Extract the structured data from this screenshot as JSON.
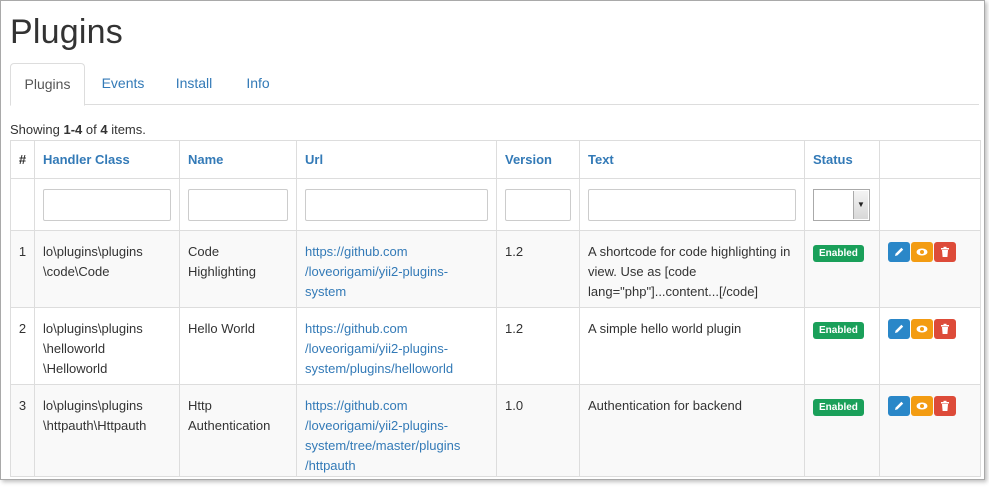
{
  "page": {
    "title": "Plugins"
  },
  "tabs": [
    {
      "label": "Plugins",
      "active": true
    },
    {
      "label": "Events"
    },
    {
      "label": "Install"
    },
    {
      "label": "Info"
    }
  ],
  "summary": {
    "prefix": "Showing ",
    "range": "1-4",
    "middle": " of ",
    "total": "4",
    "suffix": " items."
  },
  "table": {
    "headers": {
      "hash": "#",
      "handler": "Handler Class",
      "name": "Name",
      "url": "Url",
      "version": "Version",
      "text": "Text",
      "status": "Status"
    },
    "rows": [
      {
        "num": "1",
        "handler": [
          "lo\\plugins\\plugins",
          "\\code\\Code"
        ],
        "name": [
          "Code",
          "Highlighting"
        ],
        "url": [
          "https://github.com",
          "/loveorigami/yii2-plugins-",
          "system"
        ],
        "version": "1.2",
        "text": [
          "A shortcode for code highlighting in",
          "view. Use as [code",
          "lang=\"php\"]...content...[/code]"
        ],
        "status": "Enabled"
      },
      {
        "num": "2",
        "handler": [
          "lo\\plugins\\plugins",
          "\\helloworld",
          "\\Helloworld"
        ],
        "name": [
          "Hello World"
        ],
        "url": [
          "https://github.com",
          "/loveorigami/yii2-plugins-",
          "system/plugins/helloworld"
        ],
        "version": "1.2",
        "text": [
          "A simple hello world plugin"
        ],
        "status": "Enabled"
      },
      {
        "num": "3",
        "handler": [
          "lo\\plugins\\plugins",
          "\\httpauth\\Httpauth"
        ],
        "name": [
          "Http",
          "Authentication"
        ],
        "url": [
          "https://github.com",
          "/loveorigami/yii2-plugins-",
          "system/tree/master/plugins",
          "/httpauth"
        ],
        "version": "1.0",
        "text": [
          "Authentication for backend"
        ],
        "status": "Enabled"
      }
    ]
  },
  "colors": {
    "link": "#337ab7",
    "enabled": "#1aa05a",
    "edit": "#2a87c8",
    "view": "#f39c12",
    "delete": "#dd4b39"
  },
  "icons": {
    "edit": "pencil-icon",
    "view": "eye-icon",
    "delete": "trash-icon",
    "dropdown": "caret-down-icon"
  }
}
